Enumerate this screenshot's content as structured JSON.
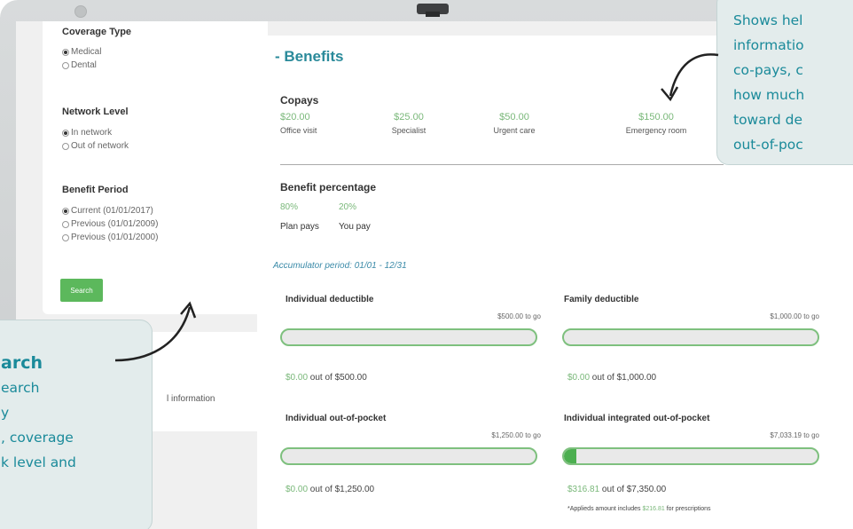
{
  "sidebar": {
    "coverage_type": {
      "title": "Coverage Type",
      "options": [
        "Medical",
        "Dental"
      ],
      "selected": "Medical"
    },
    "network_level": {
      "title": "Network Level",
      "options": [
        "In network",
        "Out of network"
      ],
      "selected": "In network"
    },
    "benefit_period": {
      "title": "Benefit Period",
      "options": [
        "Current (01/01/2017)",
        "Previous (01/01/2009)",
        "Previous (01/01/2000)"
      ],
      "selected": "Current (01/01/2017)"
    },
    "search_label": "Search",
    "panel2_text": "l information"
  },
  "benefits": {
    "title": "- Benefits",
    "copays": {
      "title": "Copays",
      "items": [
        {
          "amount": "$20.00",
          "label": "Office visit"
        },
        {
          "amount": "$25.00",
          "label": "Specialist"
        },
        {
          "amount": "$50.00",
          "label": "Urgent care"
        },
        {
          "amount": "$150.00",
          "label": "Emergency room"
        }
      ]
    },
    "benefit_percentage": {
      "title": "Benefit percentage",
      "plan_pays_value": "80%",
      "plan_pays_label": "Plan pays",
      "you_pay_value": "20%",
      "you_pay_label": "You pay"
    },
    "accumulator_period": "Accumulator period: 01/01 - 12/31",
    "accumulators": [
      {
        "title": "Individual deductible",
        "to_go": "$500.00 to go",
        "spent": "$0.00",
        "limit_text": " out of $500.00",
        "progress": 0.0
      },
      {
        "title": "Family deductible",
        "to_go": "$1,000.00 to go",
        "spent": "$0.00",
        "limit_text": " out of $1,000.00",
        "progress": 0.0
      },
      {
        "title": "Individual out-of-pocket",
        "to_go": "$1,250.00 to go",
        "spent": "$0.00",
        "limit_text": " out of $1,250.00",
        "progress": 0.0
      },
      {
        "title": "Individual integrated out-of-pocket",
        "to_go": "$7,033.19 to go",
        "spent": "$316.81",
        "limit_text": " out of $7,350.00",
        "progress": 0.043
      }
    ],
    "note_prefix": "*Applieds amount includes ",
    "note_amount": "$216.81",
    "note_suffix": " for prescriptions"
  },
  "callout_right": {
    "lines": [
      "Shows hel",
      "informatio",
      "co-pays, c",
      "how much",
      "toward de",
      "out-of-poc"
    ]
  },
  "callout_left": {
    "heading": "arch",
    "lines": [
      "earch",
      "y",
      ", coverage",
      "k level and"
    ]
  },
  "colors": {
    "accent": "#1a8a9a",
    "green": "#5cb85c",
    "callout_bg": "#e3ecec"
  }
}
